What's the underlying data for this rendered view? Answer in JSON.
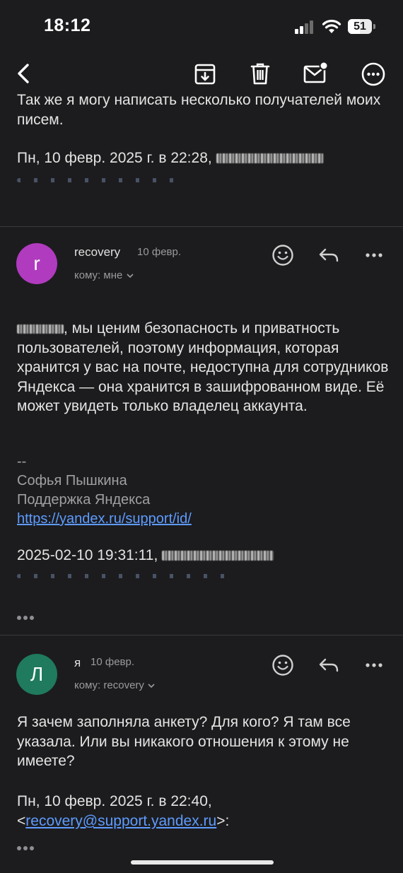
{
  "status_bar": {
    "time": "18:12",
    "battery": "51",
    "battery_level": 0.51
  },
  "toolbar": {
    "back_icon": "chevron-left-icon",
    "archive_icon": "archive-icon",
    "delete_icon": "trash-icon",
    "unread_icon": "mail-unread-icon",
    "more_icon": "more-icon"
  },
  "previous_message": {
    "body": "Так же я могу написать несколько получателей моих писем.",
    "date_line": "Пн, 10 февр. 2025 г. в 22:28,"
  },
  "messages": [
    {
      "sender": "recovery",
      "date": "10 февр.",
      "avatar_letter": "r",
      "avatar_color": "#b03bbf",
      "to": "кому: мне",
      "body_blurred_prefix": true,
      "body": ", мы ценим безопасность и приватность пользователей, поэтому информация, которая хранится у вас на почте, недоступна для сотрудников Яндекса — она хранится в зашифрованном виде. Её может увидеть только владелец аккаунта.",
      "sig_dash": "--",
      "sig_name": "Софья Пышкина",
      "sig_team": "Поддержка Яндекса",
      "sig_link": "https://yandex.ru/support/id/",
      "quote_date": "2025-02-10 19:31:11,"
    },
    {
      "sender": "я",
      "date": "10 февр.",
      "avatar_letter": "Л",
      "avatar_color": "#1f7a5e",
      "to": "кому: recovery",
      "body": "Я зачем заполняла анкету? Для кого? Я там все указала. Или вы никакого отношения к этому не имеете?",
      "quote_date": "Пн, 10 февр. 2025 г. в 22:40,",
      "quote_open": "<",
      "quote_email": "recovery@support.yandex.ru",
      "quote_close": ">:"
    }
  ],
  "icons": {
    "react": "emoji-smile-icon",
    "reply": "reply-icon",
    "more": "more-horizontal-icon"
  }
}
